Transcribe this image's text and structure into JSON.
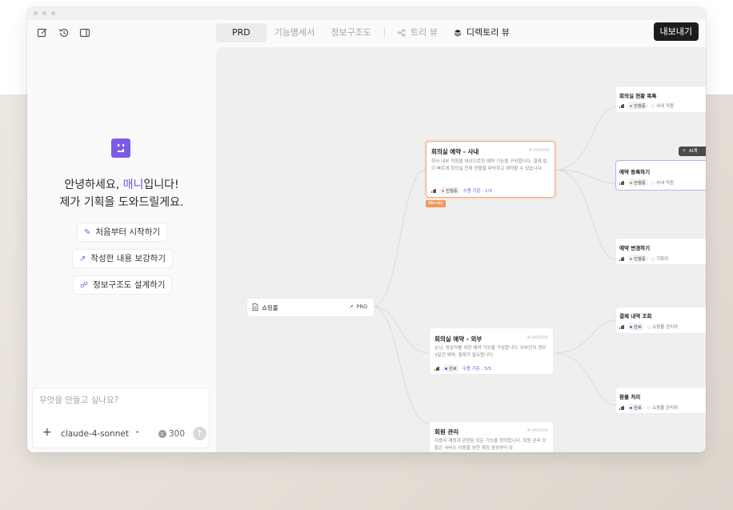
{
  "toolbar": {
    "tabs": [
      "PRD",
      "기능명세서",
      "정보구조도",
      "트리 뷰",
      "디렉토리 뷰"
    ],
    "export_label": "내보내기"
  },
  "assistant": {
    "greeting_line1_prefix": "안녕하세요, ",
    "greeting_name": "매니",
    "greeting_line1_suffix": "입니다!",
    "greeting_line2": "제가 기획을 도와드릴게요.",
    "actions": [
      "처음부터 시작하기",
      "작성한 내용 보강하기",
      "정보구조도 설계하기"
    ],
    "input_placeholder": "무엇을 만들고 싶나요?",
    "model": "claude-4-sonnet",
    "credits": "300"
  },
  "canvas": {
    "root": {
      "title": "쇼핑몰",
      "tag": "PRD"
    },
    "wendy_label": "Wendy",
    "ai_tag": "AI계",
    "nodes": [
      {
        "title": "회의실 예약 - 사내",
        "id": "#-AM9ISW",
        "desc": "회사 내부 직원을 대상으로한 예약 기능을 구성합니다. 결제 없이 빠르게 회의실 전체 현황을 파악하고 예약할 수 있습니다.",
        "status": "진행중",
        "req": "수용 기준 : 1/3"
      },
      {
        "title": "회의실 예약 - 외부",
        "id": "#-AM9ISW",
        "desc": "손님, 방문자를 위한 예약 기능을 구성합니다. 외부인의 경우 3일전 예약, 결제가 필요합니다.",
        "status": "완료",
        "req": "수용 기준 : 5/5"
      },
      {
        "title": "회원 관리",
        "id": "#-AM9ISW",
        "desc": "사용자 계정과 관련된 모든 기능을 정의합니다. 회원 관리 모듈은 서비스 이용을 위한 계정 생성부터 유",
        "status": "",
        "req": ""
      },
      {
        "title": "회의실 현황 목록",
        "status": "진행중",
        "owner": "사내 직원"
      },
      {
        "title": "예약 등록하기",
        "status": "진행중",
        "owner": "사내 직원"
      },
      {
        "title": "예약 변경하기",
        "status": "진행중",
        "owner": "기획자"
      },
      {
        "title": "결제 내역 조회",
        "status": "완료",
        "owner": "쇼핑몰 관리자"
      },
      {
        "title": "환불 처리",
        "status": "완료",
        "owner": "쇼핑몰 관리자"
      }
    ]
  },
  "colors": {
    "accent": "#6b56e0",
    "selected": "#f0a87c",
    "in_progress": "#f08a4b",
    "done": "#6b56e0"
  }
}
